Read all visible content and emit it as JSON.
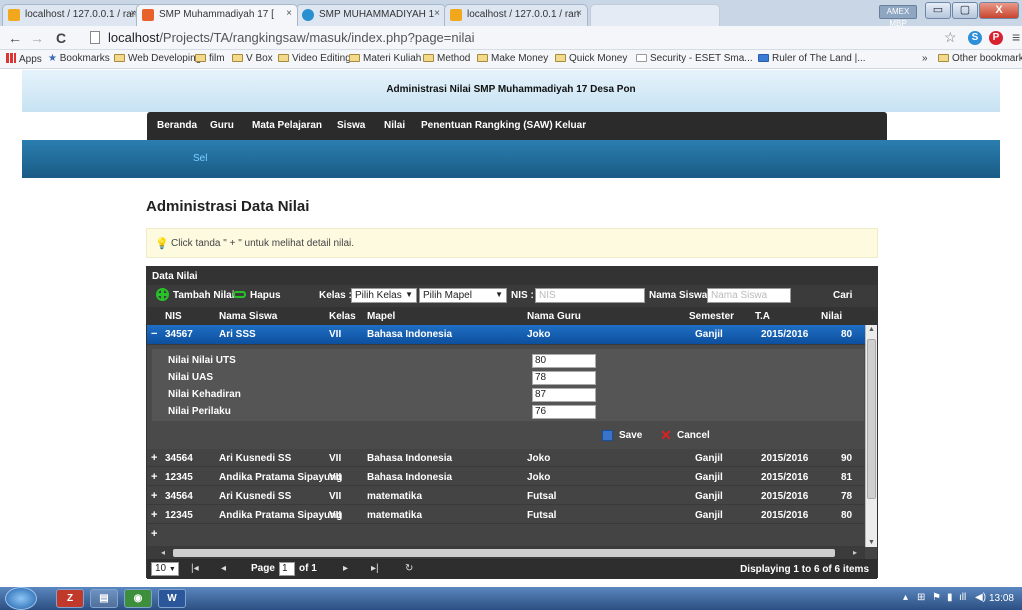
{
  "browser": {
    "tabs": [
      {
        "title": "localhost / 127.0.0.1 / ran",
        "close": "×",
        "favicon_color": "#f2a81d"
      },
      {
        "title": "SMP Muhammadiyah 17 [",
        "close": "×",
        "favicon_color": "#e8632b"
      },
      {
        "title": "SMP MUHAMMADIYAH 1",
        "close": "×",
        "favicon_color": "#2a8fd0"
      },
      {
        "title": "localhost / 127.0.0.1 / ran",
        "close": "×",
        "favicon_color": "#f2a81d"
      }
    ],
    "win_user": "AMEX MBP",
    "win_buttons": {
      "minimize": "▭",
      "maximize": "▢",
      "close": "X"
    },
    "url_host": "localhost",
    "url_path": "/Projects/TA/rangkingsaw/masuk/index.php?page=nilai",
    "nav_back": "←",
    "nav_forward": "→",
    "nav_reload": "C",
    "star": "☆",
    "ext_skype": "S",
    "ext_pinterest": "P",
    "menu": "≡",
    "bookmarks": {
      "apps": "Apps",
      "bookmarks_label": "Bookmarks",
      "items": [
        "Web Developing",
        "film",
        "V Box",
        "Video Editing",
        "Materi Kuliah",
        "Method",
        "Make Money",
        "Quick Money",
        "Security - ESET Sma...",
        "Ruler of The Land |..."
      ],
      "overflow": "»",
      "other": "Other bookmarks"
    }
  },
  "site": {
    "title": "Administrasi Nilai SMP Muhammadiyah 17 Desa Pon",
    "nav": [
      "Beranda",
      "Guru",
      "Mata Pelajaran",
      "Siswa",
      "Nilai",
      "Penentuan Rangking (SAW)",
      "Keluar"
    ],
    "subnav": "Sel"
  },
  "content": {
    "heading": "Administrasi Data Nilai",
    "info": "Click tanda \" + \" untuk melihat detail nilai."
  },
  "grid": {
    "title": "Data Nilai",
    "toolbar": {
      "add": "Tambah Nilai",
      "delete": "Hapus",
      "kelas_label": "Kelas :",
      "kelas_value": "Pilih Kelas",
      "mapel_value": "Pilih Mapel",
      "nis_label": "NIS :",
      "nis_placeholder": "NIS",
      "nama_label": "Nama Siswa :",
      "nama_placeholder": "Nama Siswa",
      "search": "Cari",
      "arrow": "▼"
    },
    "columns": [
      "NIS",
      "Nama Siswa",
      "Kelas",
      "Mapel",
      "Nama Guru",
      "Semester",
      "T.A",
      "Nilai"
    ],
    "rows": [
      {
        "sign": "−",
        "nis": "34567",
        "nama": "Ari SSS",
        "kelas": "VII",
        "mapel": "Bahasa Indonesia",
        "guru": "Joko",
        "semester": "Ganjil",
        "ta": "2015/2016",
        "nilai": "80"
      },
      {
        "sign": "+",
        "nis": "34564",
        "nama": "Ari Kusnedi SS",
        "kelas": "VII",
        "mapel": "Bahasa Indonesia",
        "guru": "Joko",
        "semester": "Ganjil",
        "ta": "2015/2016",
        "nilai": "90"
      },
      {
        "sign": "+",
        "nis": "12345",
        "nama": "Andika Pratama Sipayung",
        "kelas": "VII",
        "mapel": "Bahasa Indonesia",
        "guru": "Joko",
        "semester": "Ganjil",
        "ta": "2015/2016",
        "nilai": "81"
      },
      {
        "sign": "+",
        "nis": "34564",
        "nama": "Ari Kusnedi SS",
        "kelas": "VII",
        "mapel": "matematika",
        "guru": "Futsal",
        "semester": "Ganjil",
        "ta": "2015/2016",
        "nilai": "78"
      },
      {
        "sign": "+",
        "nis": "12345",
        "nama": "Andika Pratama Sipayung",
        "kelas": "VII",
        "mapel": "matematika",
        "guru": "Futsal",
        "semester": "Ganjil",
        "ta": "2015/2016",
        "nilai": "80"
      }
    ],
    "detail": {
      "fields": [
        {
          "label": "Nilai Nilai UTS",
          "value": "80"
        },
        {
          "label": "Nilai UAS",
          "value": "78"
        },
        {
          "label": "Nilai Kehadiran",
          "value": "87"
        },
        {
          "label": "Nilai Perilaku",
          "value": "76"
        }
      ],
      "save": "Save",
      "cancel": "Cancel"
    },
    "pager": {
      "page_size": "10",
      "first": "|◂",
      "prev": "◂",
      "page_label": "Page",
      "page_value": "1",
      "of": "of 1",
      "next": "▸",
      "last": "▸|",
      "refresh": "↻",
      "info": "Displaying 1 to 6 of 6 items"
    },
    "scroll": {
      "up": "▲",
      "down": "▼",
      "left": "◂",
      "right": "▸"
    }
  },
  "taskbar": {
    "apps": [
      "Z",
      "▤",
      "◉",
      "W"
    ],
    "tray": [
      "▴",
      "⊞",
      "⚑",
      "▮",
      "ıll",
      "◀)"
    ],
    "clock": "13:08"
  },
  "colors": {
    "accent_blue": "#1f6fc4",
    "add_green": "#27c227",
    "cancel_red": "#e02020"
  }
}
